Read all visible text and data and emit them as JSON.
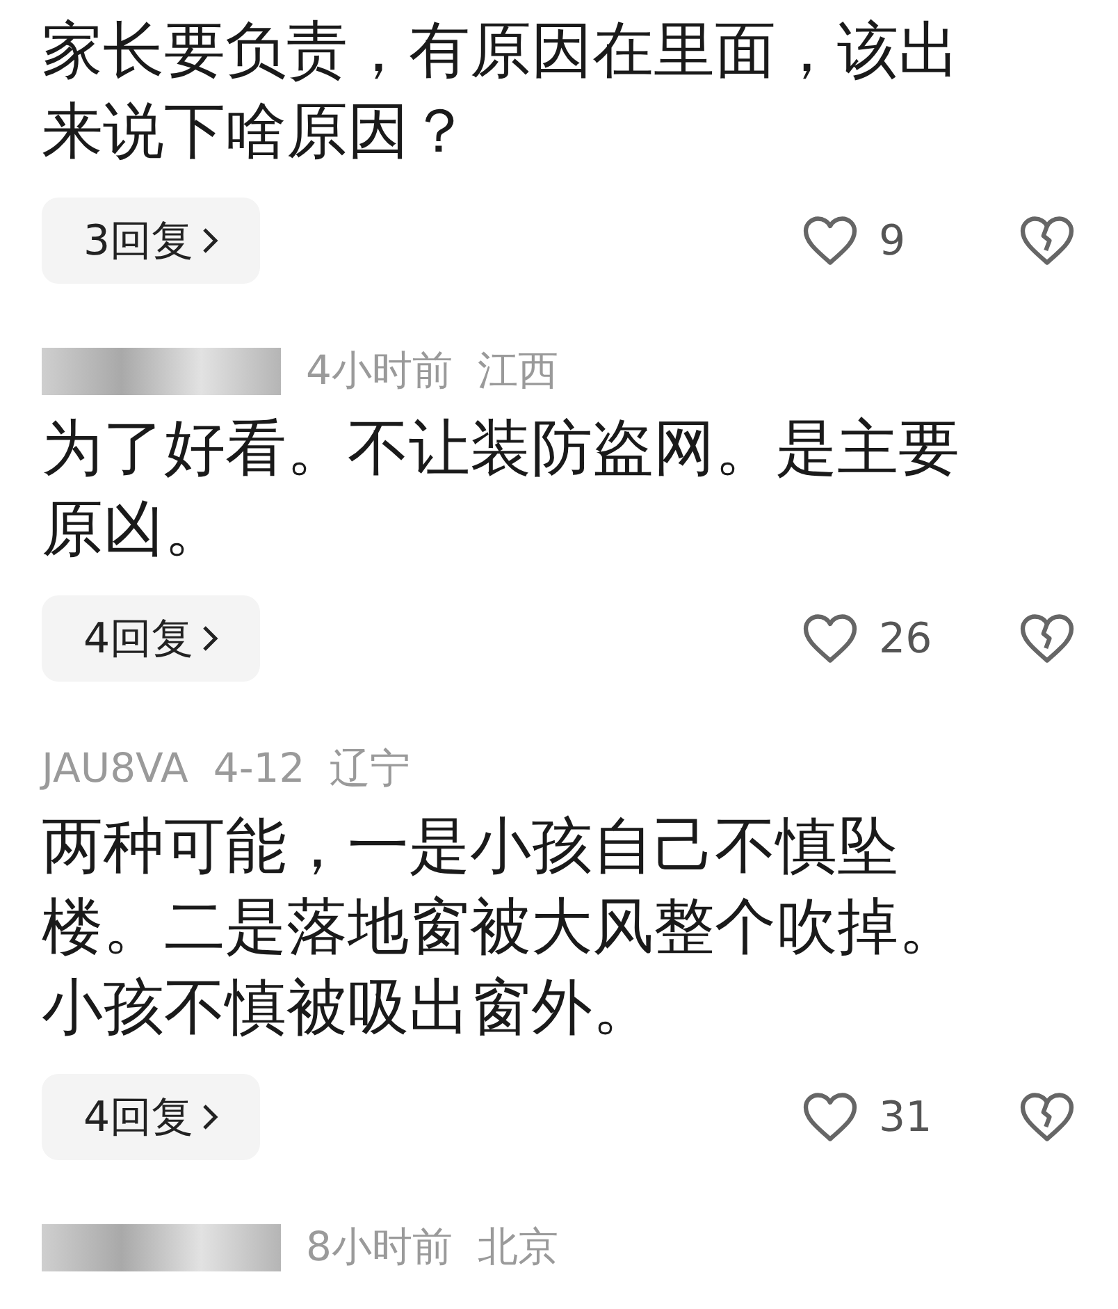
{
  "comments": [
    {
      "text": "家长要负责，有原因在里面，该出来说下啥原因？",
      "replies": "3回复",
      "likes": "9"
    },
    {
      "header": {
        "time": "4小时前",
        "location": "江西"
      },
      "text": "为了好看。不让装防盗网。是主要原凶。",
      "replies": "4回复",
      "likes": "26"
    },
    {
      "header": {
        "username": "JAU8VA",
        "time": "4-12",
        "location": "辽宁"
      },
      "text": "两种可能，一是小孩自己不慎坠楼。二是落地窗被大风整个吹掉。小孩不慎被吸出窗外。",
      "replies": "4回复",
      "likes": "31"
    },
    {
      "header": {
        "time": "8小时前",
        "location": "北京"
      }
    }
  ]
}
